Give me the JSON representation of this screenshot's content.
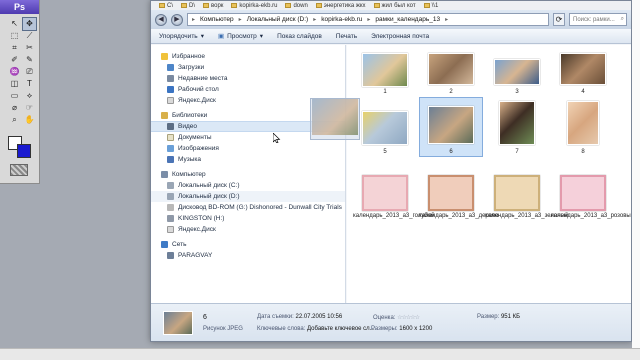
{
  "photoshop": {
    "logo": "Ps",
    "tools": [
      "↖",
      "✥",
      "⬚",
      "⟋",
      "⌗",
      "✂",
      "✐",
      "✎",
      "♒",
      "⎚",
      "◫",
      "T",
      "▭",
      "⟡",
      "⌀",
      "☞",
      "⌕",
      "✋"
    ]
  },
  "bookmarks": [
    {
      "label": "C\\"
    },
    {
      "label": "D\\"
    },
    {
      "label": "ворк"
    },
    {
      "label": "kopirka-ekb.ru"
    },
    {
      "label": "down"
    },
    {
      "label": "энергетика жкх"
    },
    {
      "label": "жил был кот"
    },
    {
      "label": "\\\\1"
    }
  ],
  "address": {
    "crumbs": [
      "Компьютер",
      "Локальный диск (D:)",
      "kopirka-ekb.ru",
      "рамки_календарь_13"
    ],
    "search_placeholder": "Поиск: рамки..."
  },
  "command_bar": {
    "organize": "Упорядочить",
    "view": "Просмотр",
    "slideshow": "Показ слайдов",
    "print": "Печать",
    "email": "Электронная почта"
  },
  "nav": {
    "favorites": {
      "label": "Избранное",
      "items": [
        "Загрузки",
        "Недавние места",
        "Рабочий стол",
        "Яндекс.Диск"
      ]
    },
    "libraries": {
      "label": "Библиотеки",
      "items": [
        "Видео",
        "Документы",
        "Изображения",
        "Музыка"
      ]
    },
    "computer": {
      "label": "Компьютер",
      "items": [
        "Локальный диск (C:)",
        "Локальный диск (D:)",
        "Дисковод BD-ROM (G:) Dishonored - Dunwall City Trials",
        "KINGSTON (H:)",
        "Яндекс.Диск"
      ]
    },
    "network": {
      "label": "Сеть",
      "items": [
        "PARAGVAY"
      ]
    }
  },
  "files": [
    {
      "name": "1"
    },
    {
      "name": "2"
    },
    {
      "name": "3"
    },
    {
      "name": "4"
    },
    {
      "name": "5"
    },
    {
      "name": "6"
    },
    {
      "name": "7"
    },
    {
      "name": "8"
    },
    {
      "name": "календарь_2013_а3_голубой"
    },
    {
      "name": "календарь_2013_а3_дерево"
    },
    {
      "name": "календарь_2013_а3_зеленый"
    },
    {
      "name": "календарь_2013_а3_розовый"
    }
  ],
  "details": {
    "name": "6",
    "type": "Рисунок JPEG",
    "date_label": "Дата съемки:",
    "date_value": "22.07.2005 10:56",
    "keywords_label": "Ключевые слова:",
    "keywords_value": "Добавьте ключевое сл...",
    "rating_label": "Оценка:",
    "rating_value": "☆☆☆☆☆",
    "size_label": "Размер:",
    "size_value": "951 КБ",
    "dims_label": "Размеры:",
    "dims_value": "1600 x 1200"
  }
}
